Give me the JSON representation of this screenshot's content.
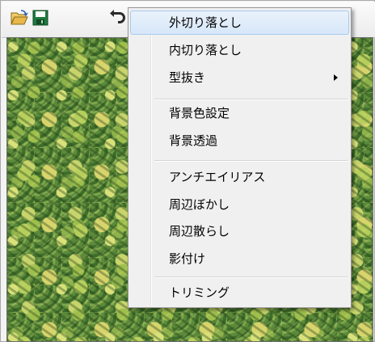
{
  "toolbar": {
    "icons": [
      "open-folder-icon",
      "save-icon",
      "undo-icon"
    ],
    "colors": {
      "folder": "#e8b84a",
      "save": "#1f7a3f",
      "undo": "#2a2a2a"
    }
  },
  "menu": {
    "items": [
      {
        "label": "外切り落とし"
      },
      {
        "label": "内切り落とし"
      },
      {
        "label": "型抜き"
      },
      {
        "label": "背景色設定"
      },
      {
        "label": "背景透過"
      },
      {
        "label": "アンチエイリアス"
      },
      {
        "label": "周辺ぼかし"
      },
      {
        "label": "周辺散らし"
      },
      {
        "label": "影付け"
      },
      {
        "label": "トリミング"
      }
    ],
    "highlighted": "外切り落とし",
    "submenu_indicator": "型抜き"
  }
}
